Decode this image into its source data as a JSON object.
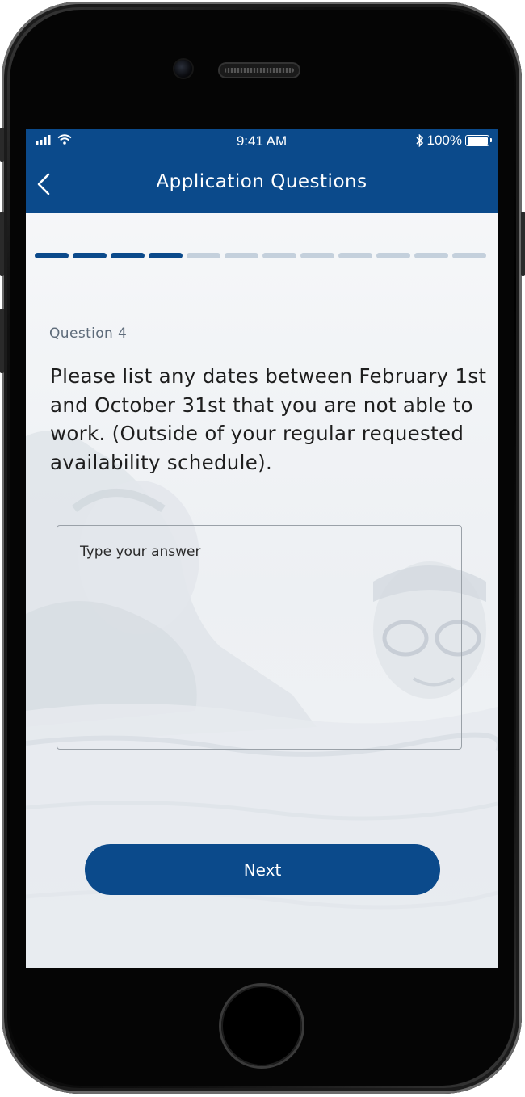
{
  "status_bar": {
    "time": "9:41 AM",
    "battery": "100%",
    "icons": [
      "cellular-signal-icon",
      "wifi-icon",
      "bluetooth-icon",
      "battery-icon"
    ]
  },
  "nav": {
    "title": "Application Questions",
    "back_icon": "chevron-left-icon"
  },
  "progress": {
    "completed_steps": 4,
    "total_steps": 12
  },
  "question": {
    "label": "Question 4",
    "text": "Please list any dates between February 1st and October 31st that you are not able to work. (Outside of your regular requested availability schedule)."
  },
  "answer": {
    "placeholder": "Type your answer",
    "value": ""
  },
  "next_button": {
    "label": "Next"
  },
  "colors": {
    "brand": "#0b4a8b",
    "progress_inactive": "#c4d0dc",
    "text": "#1e1e1e",
    "label": "#5e6b7a"
  }
}
